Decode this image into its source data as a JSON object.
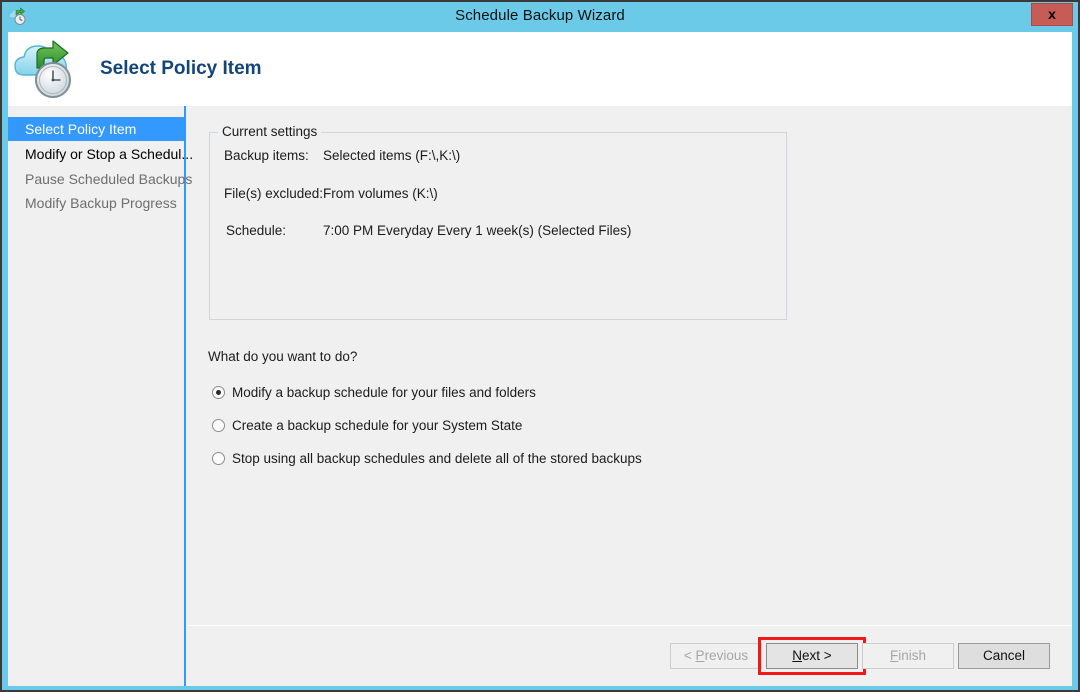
{
  "window": {
    "title": "Schedule Backup Wizard",
    "icon": "cloud-clock-icon",
    "close_label": "x",
    "accent_blue": "#3399ff",
    "titlebar_blue": "#6bcae8",
    "close_red": "#c75b55"
  },
  "header": {
    "title": "Select Policy Item",
    "icon": "cloud-upload-clock-icon"
  },
  "sidebar": {
    "items": [
      {
        "label": "Select Policy Item",
        "state": "selected"
      },
      {
        "label": "Modify or Stop a Schedul...",
        "state": "enabled"
      },
      {
        "label": "Pause Scheduled Backups",
        "state": "disabled"
      },
      {
        "label": "Modify Backup Progress",
        "state": "disabled"
      }
    ]
  },
  "current_settings": {
    "legend": "Current settings",
    "rows": [
      {
        "label": "Backup items:",
        "value": "Selected items (F:\\,K:\\)"
      },
      {
        "label": "File(s) excluded:",
        "value": "From volumes (K:\\)"
      },
      {
        "label": "Schedule:",
        "value": "7:00 PM Everyday Every 1 week(s) (Selected Files)"
      }
    ]
  },
  "main": {
    "question": "What do you want to do?",
    "options": [
      {
        "label": "Modify a backup schedule for your files and folders",
        "checked": true
      },
      {
        "label": "Create a backup schedule for your System State",
        "checked": false
      },
      {
        "label": "Stop using all backup schedules and delete all of the stored backups",
        "checked": false
      }
    ]
  },
  "footer": {
    "previous": {
      "prefix": "< ",
      "mnemonic": "P",
      "suffix": "revious",
      "enabled": false
    },
    "next": {
      "prefix": "",
      "mnemonic": "N",
      "suffix": "ext >",
      "enabled": true,
      "focused": true
    },
    "finish": {
      "prefix": "",
      "mnemonic": "F",
      "suffix": "inish",
      "enabled": false
    },
    "cancel": {
      "label": "Cancel",
      "enabled": true
    }
  }
}
